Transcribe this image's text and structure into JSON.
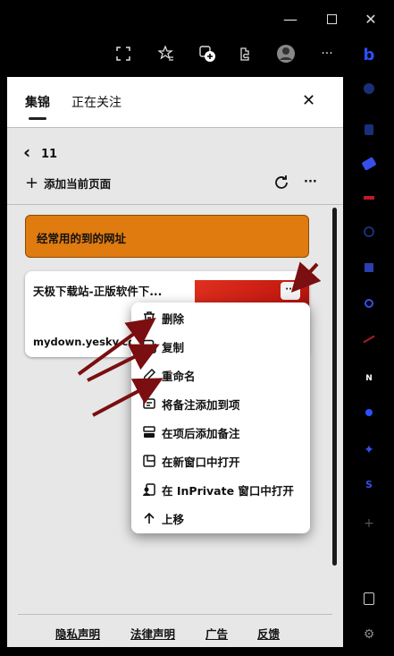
{
  "window": {
    "controls": [
      "minimize-icon",
      "maximize-icon",
      "close-icon"
    ]
  },
  "toolbar": {
    "icons": [
      "screenshot-icon",
      "favorites-icon",
      "collections-icon",
      "extensions-icon",
      "profile-icon",
      "more-icon"
    ],
    "more_label": "···"
  },
  "panel": {
    "tabs": [
      {
        "label": "集锦",
        "active": true
      },
      {
        "label": "正在关注",
        "active": false
      }
    ],
    "close_label": "✕",
    "collection": {
      "back_label": "‹",
      "title": "11",
      "add_label": "添加当前页面",
      "refresh_icon": "refresh-icon",
      "more_label": "···"
    },
    "note": {
      "text": "经常用的到的网址",
      "color": "#e07b10"
    },
    "card": {
      "title": "天极下载站-正版软件下...",
      "domain": "mydown.yesky.com",
      "more_label": "···"
    },
    "context_menu": [
      {
        "label": "删除",
        "icon": "trash-icon"
      },
      {
        "label": "复制",
        "icon": "copy-icon"
      },
      {
        "label": "重命名",
        "icon": "pencil-icon"
      },
      {
        "label": "将备注添加到项",
        "icon": "add-note-icon"
      },
      {
        "label": "在项后添加备注",
        "icon": "note-after-icon"
      },
      {
        "label": "在新窗口中打开",
        "icon": "new-window-icon"
      },
      {
        "label": "在 InPrivate 窗口中打开",
        "icon": "inprivate-icon"
      },
      {
        "label": "上移",
        "icon": "arrow-up-icon"
      }
    ],
    "footer": [
      "隐私声明",
      "法律声明",
      "广告",
      "反馈"
    ]
  },
  "sidebar": {
    "icons": [
      "bing-icon",
      "circle-icon",
      "bag-icon",
      "tag-icon",
      "games-icon",
      "search-icon",
      "app-icon",
      "office-icon",
      "send-icon",
      "news-icon",
      "person-icon",
      "skype-icon",
      "add-icon",
      "split-icon",
      "settings-icon"
    ]
  }
}
